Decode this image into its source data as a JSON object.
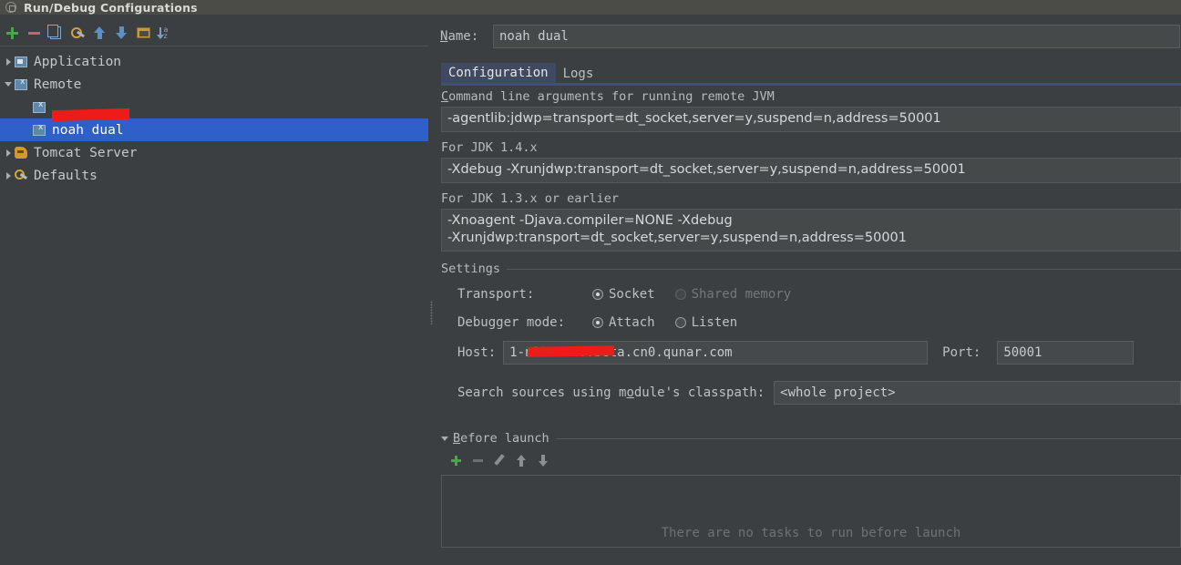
{
  "window": {
    "title": "Run/Debug Configurations",
    "title_icon": "dialog-icon"
  },
  "tree_toolbar": {
    "buttons": [
      {
        "name": "add-configuration",
        "icon": "plus-icon"
      },
      {
        "name": "remove-configuration",
        "icon": "minus-icon"
      },
      {
        "name": "copy-configuration",
        "icon": "copy-icon"
      },
      {
        "name": "edit-defaults",
        "icon": "wrench-icon"
      },
      {
        "name": "move-up",
        "icon": "arrow-up-icon"
      },
      {
        "name": "move-down",
        "icon": "arrow-down-icon"
      },
      {
        "name": "create-folder",
        "icon": "folder-icon"
      },
      {
        "name": "sort-configurations",
        "icon": "sort-az-icon"
      }
    ],
    "sort_letters": "a\nz"
  },
  "tree": {
    "items": [
      {
        "label": "Application",
        "icon": "application-icon",
        "expanded": false,
        "level": 0,
        "selected": false,
        "redacted": false
      },
      {
        "label": "Remote",
        "icon": "remote-icon",
        "expanded": true,
        "level": 0,
        "selected": false,
        "redacted": false
      },
      {
        "label": "",
        "icon": "remote-icon",
        "level": 1,
        "selected": false,
        "redacted": true
      },
      {
        "label": "noah dual",
        "icon": "remote-icon",
        "level": 1,
        "selected": true,
        "redacted": false
      },
      {
        "label": "Tomcat Server",
        "icon": "tomcat-icon",
        "expanded": false,
        "level": 0,
        "selected": false,
        "redacted": false
      },
      {
        "label": "Defaults",
        "icon": "defaults-icon",
        "expanded": false,
        "level": 0,
        "selected": false,
        "redacted": false
      }
    ]
  },
  "name_row": {
    "label": "Name:",
    "value": "noah dual"
  },
  "tabs": [
    {
      "label": "Configuration",
      "active": true
    },
    {
      "label": "Logs",
      "active": false
    }
  ],
  "jvm": {
    "cmdline_label": "Command line arguments for running remote JVM",
    "cmdline_value": "-agentlib:jdwp=transport=dt_socket,server=y,suspend=n,address=50001",
    "jdk14_label": "For JDK 1.4.x",
    "jdk14_value": "-Xdebug -Xrunjdwp:transport=dt_socket,server=y,suspend=n,address=50001",
    "jdk13_label": "For JDK 1.3.x or earlier",
    "jdk13_value_line1": "-Xnoagent -Djava.compiler=NONE -Xdebug",
    "jdk13_value_line2": "-Xrunjdwp:transport=dt_socket,server=y,suspend=n,address=50001"
  },
  "settings": {
    "group_title": "Settings",
    "transport": {
      "label": "Transport:",
      "options": [
        {
          "label": "Socket",
          "checked": true,
          "disabled": false
        },
        {
          "label": "Shared memory",
          "checked": false,
          "disabled": true
        }
      ]
    },
    "debugger_mode": {
      "label": "Debugger mode:",
      "options": [
        {
          "label": "Attach",
          "checked": true,
          "disabled": false
        },
        {
          "label": "Listen",
          "checked": false,
          "disabled": false
        }
      ]
    },
    "host": {
      "label": "Host:",
      "value_prefix": "1-n",
      "value_suffix": "21.auto.beta.cn0.qunar.com"
    },
    "port": {
      "label": "Port:",
      "value": "50001"
    },
    "search_sources": {
      "label": "Search sources using module's classpath:",
      "value": "<whole project>"
    }
  },
  "before_launch": {
    "title": "Before launch",
    "buttons": [
      {
        "name": "add-task",
        "icon": "plus-icon"
      },
      {
        "name": "remove-task",
        "icon": "minus-icon"
      },
      {
        "name": "edit-task",
        "icon": "pencil-icon"
      },
      {
        "name": "move-task-up",
        "icon": "arrow-up-icon"
      },
      {
        "name": "move-task-down",
        "icon": "arrow-down-icon"
      }
    ],
    "empty_text": "There are no tasks to run before launch"
  },
  "colors": {
    "background": "#3c3f41",
    "titlebar": "#4b4b48",
    "selection": "#2f5fc8",
    "field_background": "#45494a",
    "redaction": "#ee1b1b",
    "accent_plus": "#49a54a",
    "accent_minus": "#c4675f"
  }
}
